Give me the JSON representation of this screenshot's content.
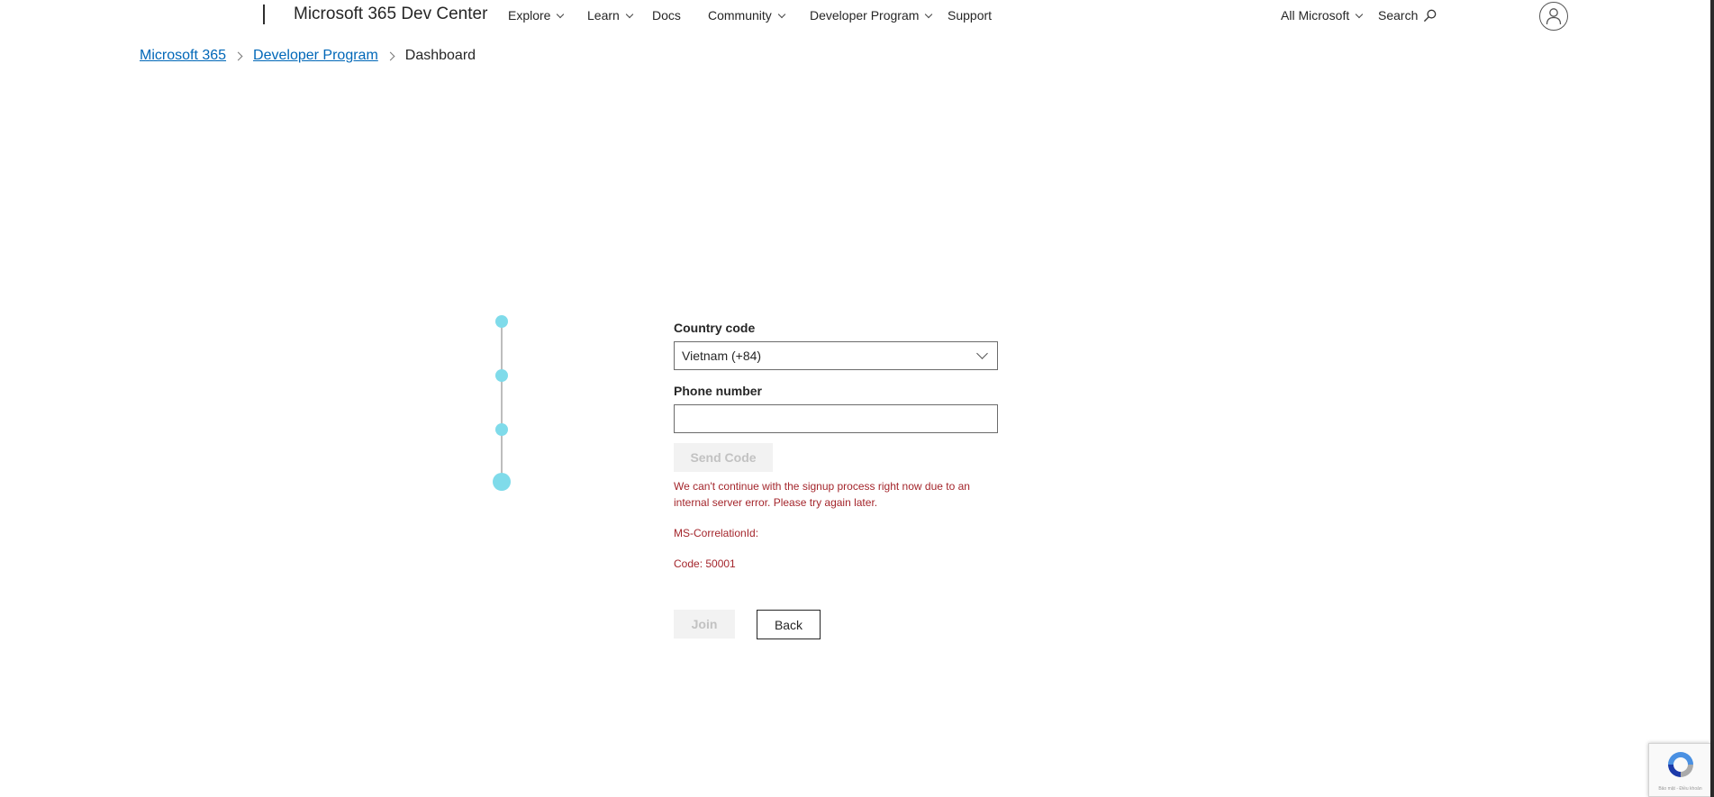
{
  "header": {
    "site_title": "Microsoft 365 Dev Center",
    "nav": [
      {
        "label": "Explore",
        "has_dropdown": true
      },
      {
        "label": "Learn",
        "has_dropdown": true
      },
      {
        "label": "Docs",
        "has_dropdown": false
      },
      {
        "label": "Community",
        "has_dropdown": true
      },
      {
        "label": "Developer Program",
        "has_dropdown": true
      },
      {
        "label": "Support",
        "has_dropdown": false
      }
    ],
    "all_microsoft": "All Microsoft",
    "search_label": "Search",
    "icons": {
      "search": "search-icon",
      "account": "user-account-icon"
    }
  },
  "breadcrumb": {
    "items": [
      {
        "label": "Microsoft 365",
        "link": true
      },
      {
        "label": "Developer Program",
        "link": true
      },
      {
        "label": "Dashboard",
        "link": false
      }
    ]
  },
  "stepper": {
    "steps": 4,
    "active_step": 4,
    "color": "#7fdbea"
  },
  "form": {
    "country_code_label": "Country code",
    "country_code_value": "Vietnam (+84)",
    "phone_label": "Phone number",
    "phone_value": "",
    "send_code_label": "Send Code",
    "error_message": "We can't continue with the signup process right now due to an internal server error. Please try again later.",
    "correlation_label": "MS-CorrelationId:",
    "code_label": "Code: 50001",
    "join_label": "Join",
    "back_label": "Back"
  },
  "recaptcha": {
    "footer_text": "Bảo mật - Điều khoản"
  },
  "colors": {
    "link": "#0067b8",
    "error": "#a4262c",
    "disabled_bg": "#f2f2f2",
    "disabled_text": "#c2c2c2"
  }
}
